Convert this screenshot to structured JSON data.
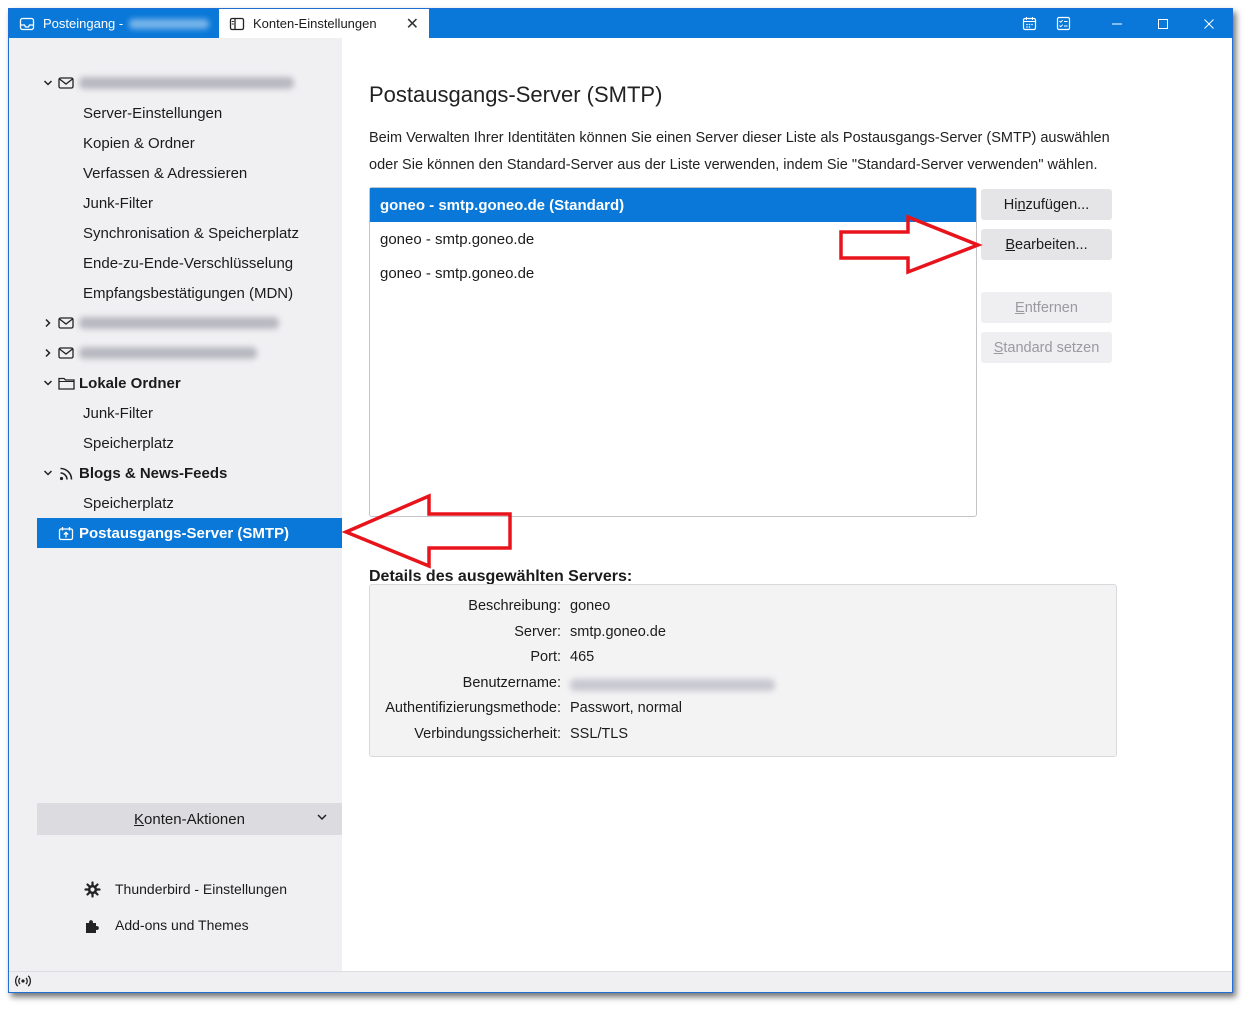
{
  "tabs": [
    {
      "label": "Posteingang -",
      "icon": "inbox-icon"
    },
    {
      "label": "Konten-Einstellungen",
      "icon": "settings-tab-icon"
    }
  ],
  "window_buttons": [
    "calendar-icon",
    "tasks-icon",
    "minimize-icon",
    "maximize-icon",
    "close-icon"
  ],
  "sidebar": {
    "account1": {
      "items": [
        "Server-Einstellungen",
        "Kopien & Ordner",
        "Verfassen & Adressieren",
        "Junk-Filter",
        "Synchronisation & Speicherplatz",
        "Ende-zu-Ende-Verschlüsselung",
        "Empfangsbestätigungen (MDN)"
      ]
    },
    "local_folders": {
      "label": "Lokale Ordner",
      "items": [
        "Junk-Filter",
        "Speicherplatz"
      ]
    },
    "feeds": {
      "label": "Blogs & News-Feeds",
      "items": [
        "Speicherplatz"
      ]
    },
    "smtp": {
      "label": "Postausgangs-Server (SMTP)"
    },
    "account_actions": {
      "label_accel": "K",
      "label_rest": "onten-Aktionen"
    },
    "footer": {
      "settings": "Thunderbird - Einstellungen",
      "addons": "Add-ons und Themes"
    }
  },
  "main": {
    "title": "Postausgangs-Server (SMTP)",
    "description": "Beim Verwalten Ihrer Identitäten können Sie einen Server dieser Liste als Postausgangs-Server (SMTP) auswählen oder Sie können den Standard-Server aus der Liste verwenden, indem Sie \"Standard-Server verwenden\" wählen.",
    "servers": [
      "goneo - smtp.goneo.de (Standard)",
      "goneo - smtp.goneo.de",
      "goneo - smtp.goneo.de"
    ],
    "buttons": {
      "add": {
        "pre": "Hi",
        "accel": "n",
        "post": "zufügen..."
      },
      "edit": {
        "pre": "",
        "accel": "B",
        "post": "earbeiten..."
      },
      "remove": {
        "pre": "",
        "accel": "E",
        "post": "ntfernen"
      },
      "set_default": {
        "pre": "",
        "accel": "S",
        "post": "tandard setzen"
      }
    },
    "details": {
      "title": "Details des ausgewählten Servers:",
      "rows": [
        {
          "label": "Beschreibung:",
          "value": "goneo"
        },
        {
          "label": "Server:",
          "value": "smtp.goneo.de"
        },
        {
          "label": "Port:",
          "value": "465"
        },
        {
          "label": "Benutzername:",
          "value": ""
        },
        {
          "label": "Authentifizierungsmethode:",
          "value": "Passwort, normal"
        },
        {
          "label": "Verbindungssicherheit:",
          "value": "SSL/TLS"
        }
      ]
    }
  },
  "colors": {
    "accent": "#0a78d8",
    "annotation_arrow": "#e8141c"
  }
}
